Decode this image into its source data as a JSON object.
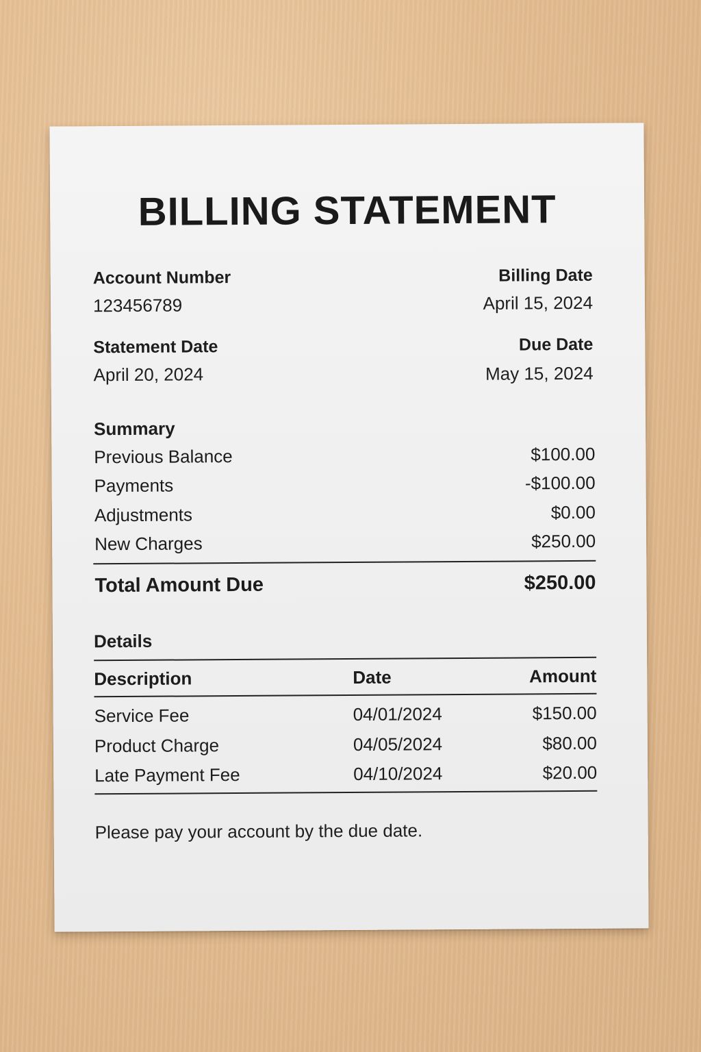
{
  "title": "BILLING STATEMENT",
  "fields": {
    "account_number_label": "Account Number",
    "account_number": "123456789",
    "billing_date_label": "Billing Date",
    "billing_date": "April 15, 2024",
    "statement_date_label": "Statement Date",
    "statement_date": "April 20, 2024",
    "due_date_label": "Due Date",
    "due_date": "May 15, 2024"
  },
  "summary": {
    "title": "Summary",
    "rows": [
      {
        "label": "Previous Balance",
        "amount": "$100.00"
      },
      {
        "label": "Payments",
        "amount": "-$100.00"
      },
      {
        "label": "Adjustments",
        "amount": "$0.00"
      },
      {
        "label": "New Charges",
        "amount": "$250.00"
      }
    ],
    "total_label": "Total Amount Due",
    "total_amount": "$250.00"
  },
  "details": {
    "title": "Details",
    "headers": {
      "description": "Description",
      "date": "Date",
      "amount": "Amount"
    },
    "rows": [
      {
        "description": "Service Fee",
        "date": "04/01/2024",
        "amount": "$150.00"
      },
      {
        "description": "Product Charge",
        "date": "04/05/2024",
        "amount": "$80.00"
      },
      {
        "description": "Late Payment Fee",
        "date": "04/10/2024",
        "amount": "$20.00"
      }
    ]
  },
  "footer_note": "Please pay your account by the due date."
}
